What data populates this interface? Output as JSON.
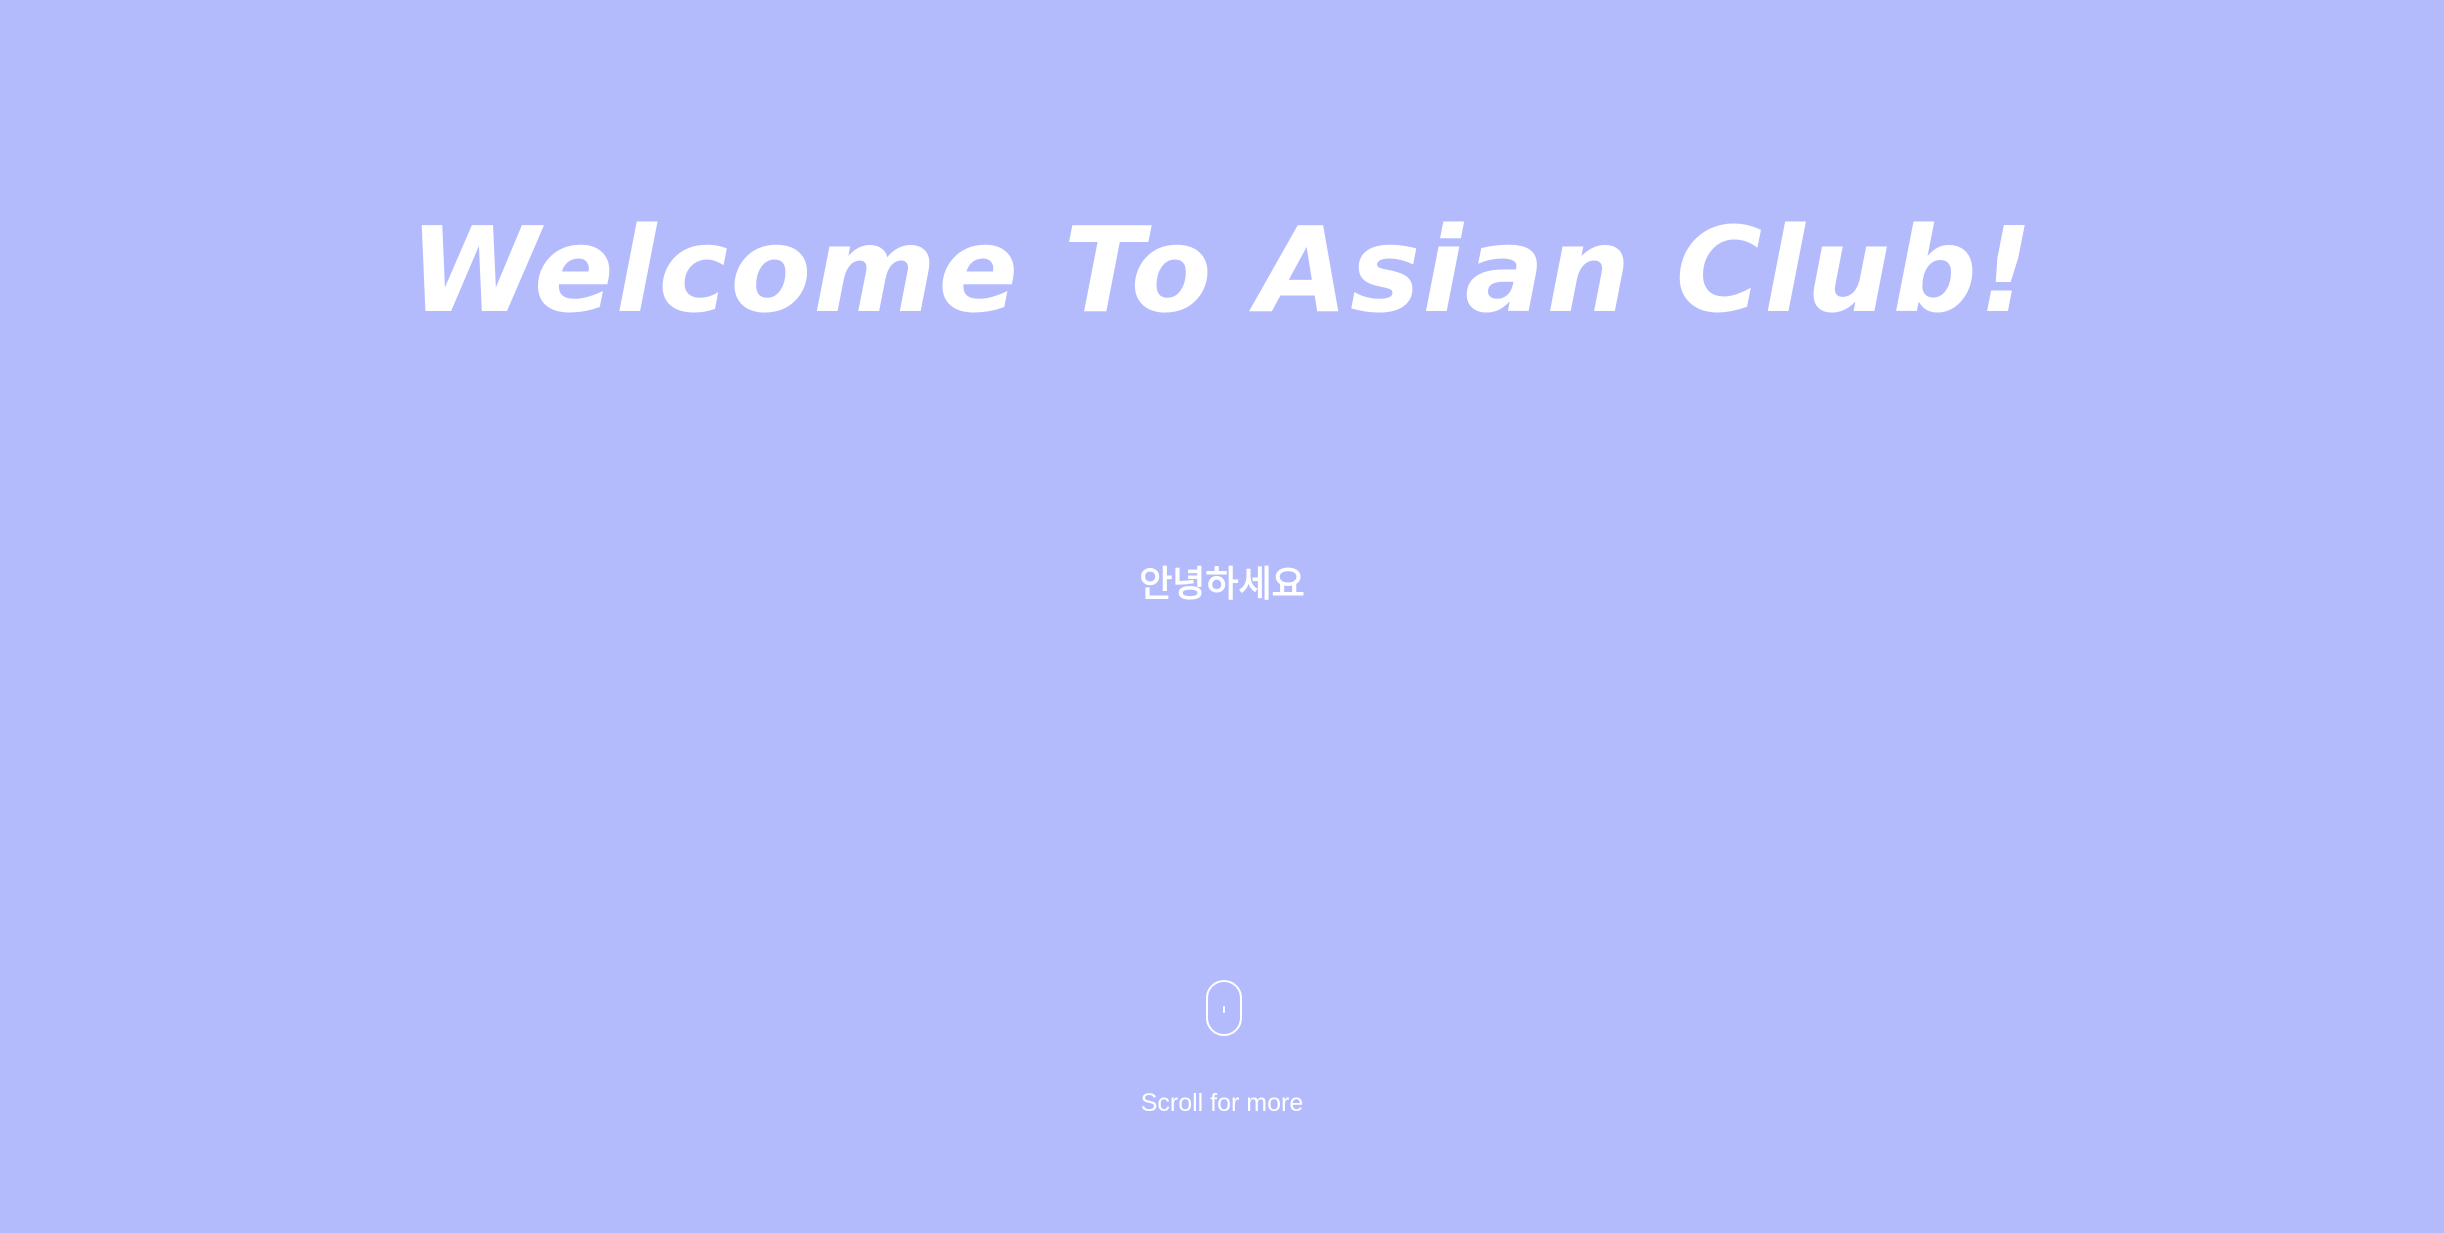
{
  "hero": {
    "title": "Welcome To Asian Club!",
    "greeting": "안녕하세요"
  },
  "scroll": {
    "icon": "mouse-scroll-icon",
    "label": "Scroll for more"
  },
  "colors": {
    "background": "#b3bbfd",
    "text": "#ffffff"
  }
}
